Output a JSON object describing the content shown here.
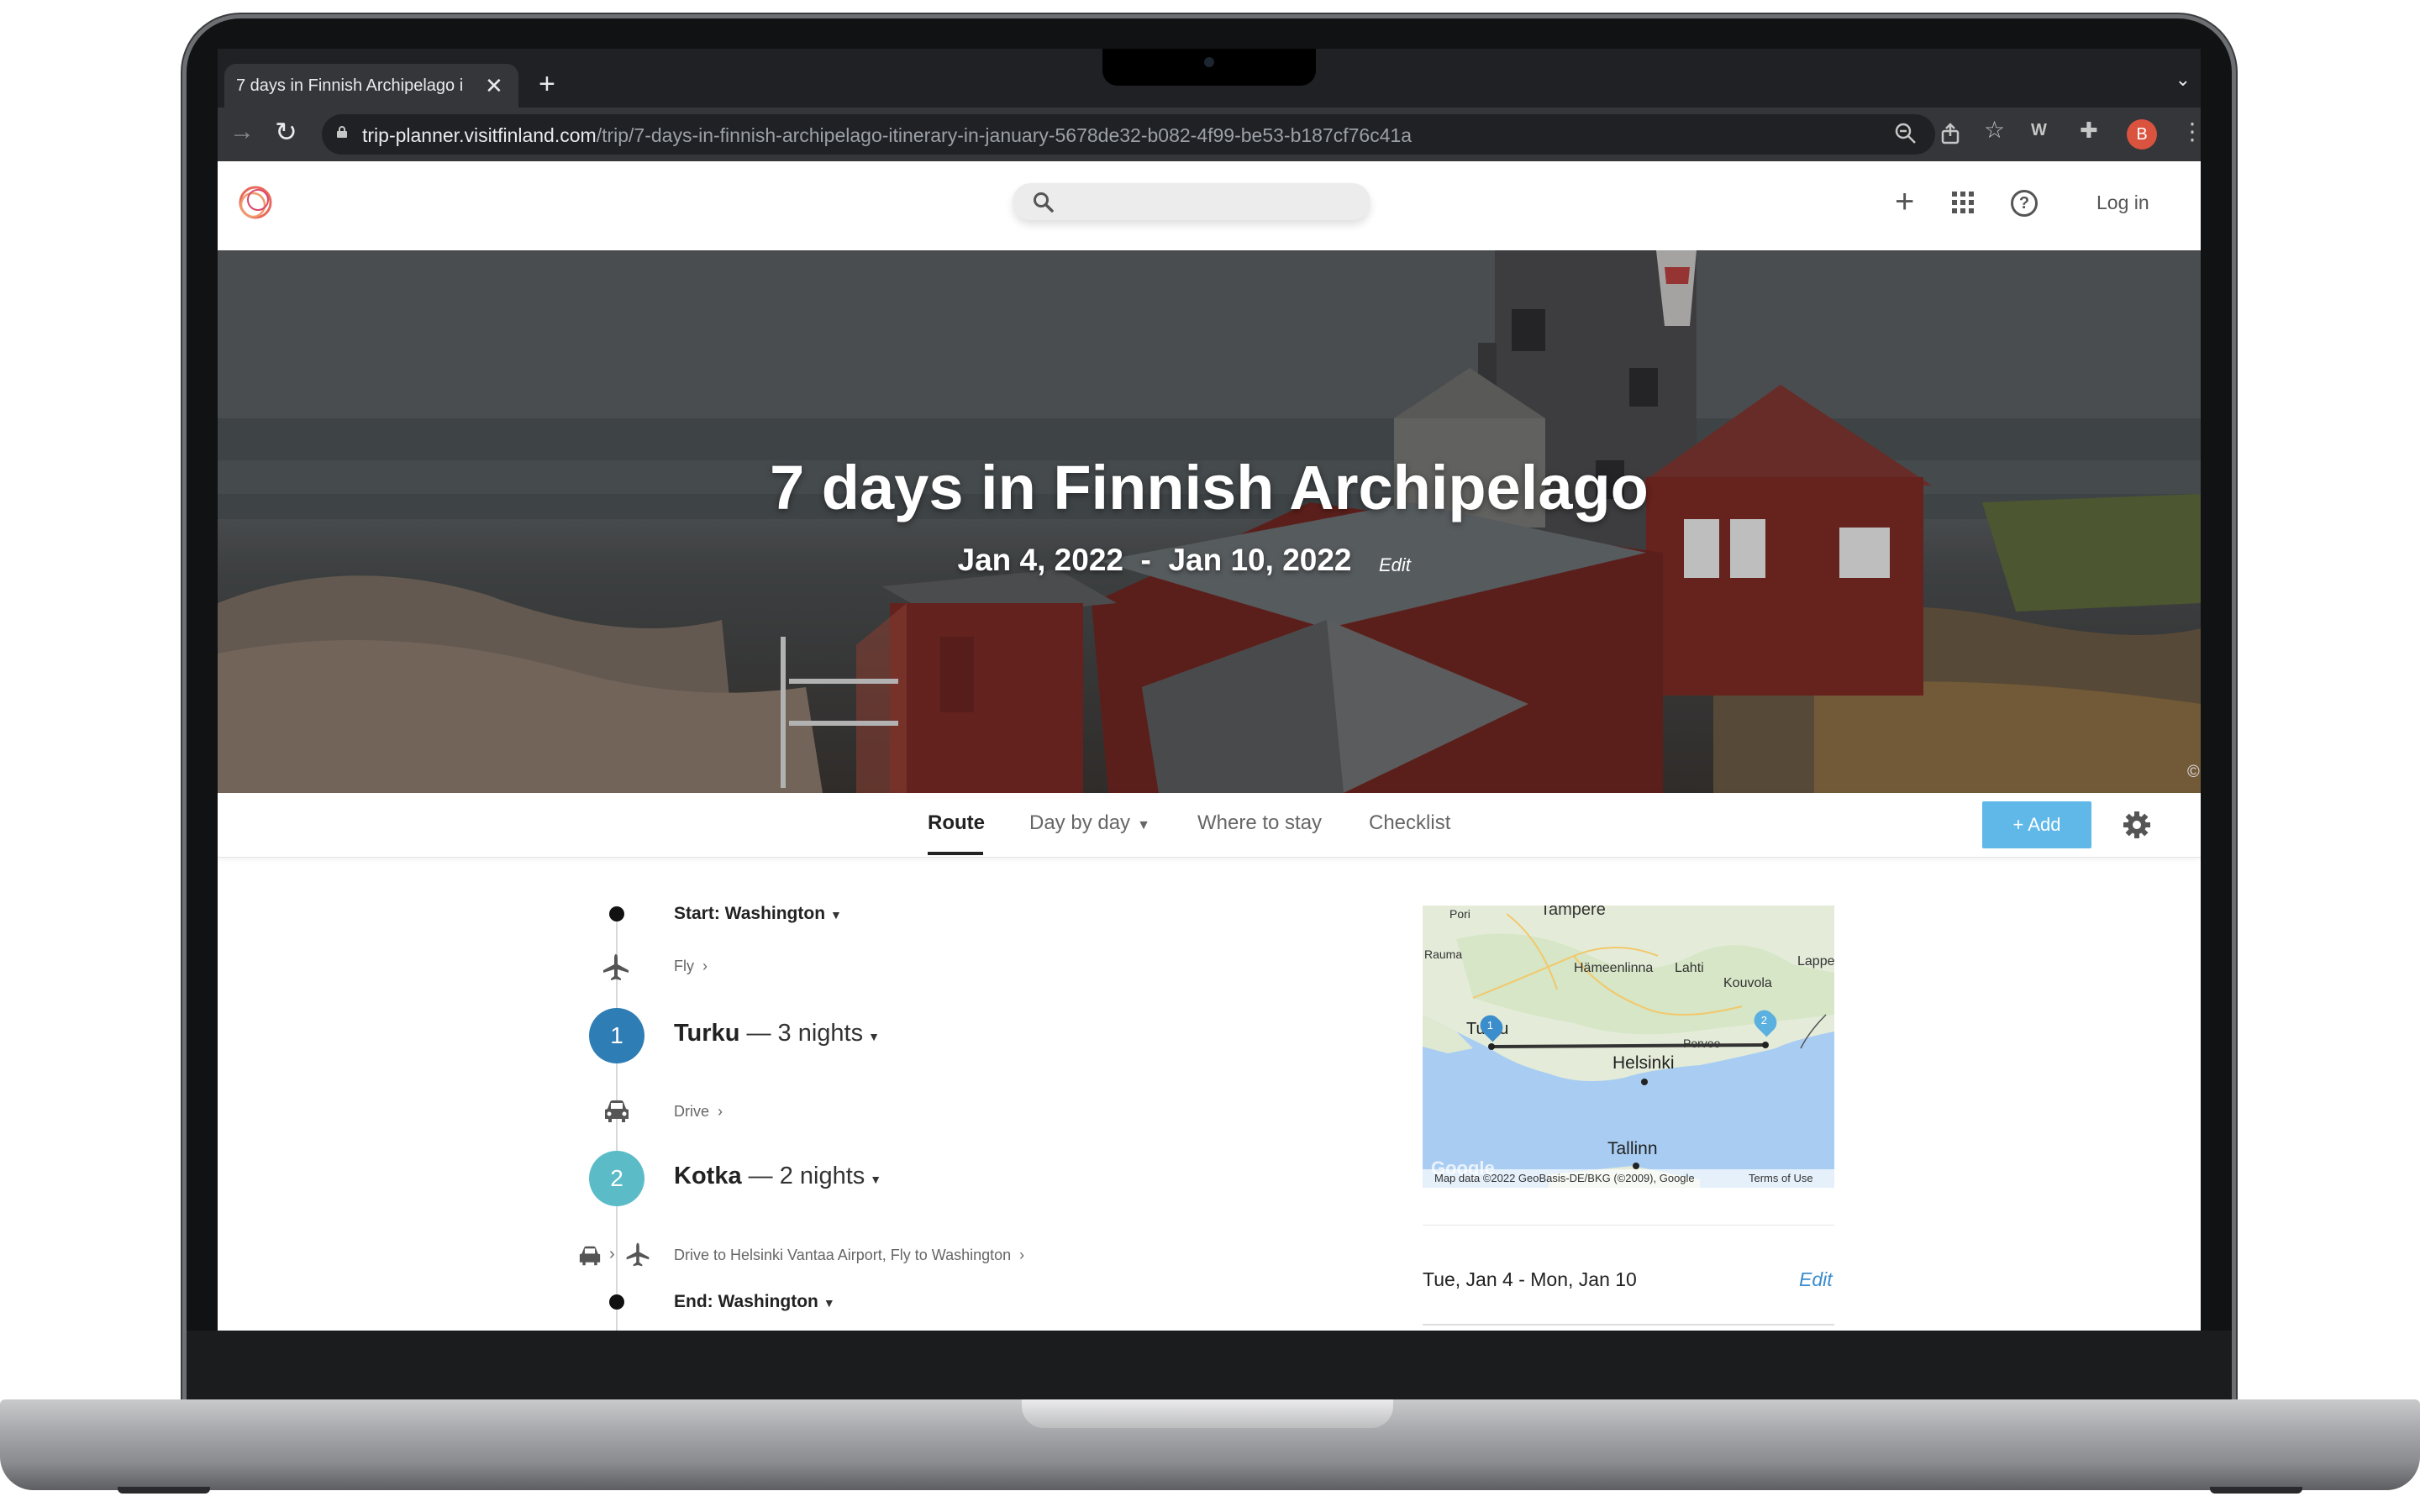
{
  "browser": {
    "tab_title": "7 days in Finnish Archipelago i",
    "tab_close": "✕",
    "new_tab": "+",
    "url_host": "trip-planner.visitfinland.com",
    "url_path": "/trip/7-days-in-finnish-archipelago-itinerary-in-january-5678de32-b082-4f99-be53-b187cf76c41a",
    "profile_initial": "B"
  },
  "header": {
    "search_placeholder": "",
    "login_label": "Log in",
    "plus_label": "+",
    "help_label": "?"
  },
  "hero": {
    "title": "7 days in Finnish Archipelago",
    "date_start": "Jan 4, 2022",
    "date_sep": "-",
    "date_end": "Jan 10, 2022",
    "edit_label": "Edit",
    "copyright": "©"
  },
  "subnav": {
    "tabs": [
      {
        "label": "Route"
      },
      {
        "label": "Day by day"
      },
      {
        "label": "Where to stay"
      },
      {
        "label": "Checklist"
      }
    ],
    "add_label": "+ Add"
  },
  "route": {
    "start_label": "Start: Washington",
    "fly_label": "Fly",
    "stops": [
      {
        "number": "1",
        "city": "Turku",
        "nights": "— 3 nights",
        "color": "#2f7db5"
      },
      {
        "number": "2",
        "city": "Kotka",
        "nights": "— 2 nights",
        "color": "#5bbcc8"
      }
    ],
    "drive_label": "Drive",
    "return_label": "Drive to Helsinki Vantaa Airport, Fly to Washington",
    "end_label": "End: Washington"
  },
  "map": {
    "labels": {
      "pori": "Pori",
      "tampere": "Tampere",
      "rauma": "Rauma",
      "hameenlinna": "Hämeenlinna",
      "lahti": "Lahti",
      "kouvola": "Kouvola",
      "lappe": "Lappe",
      "turku": "Turku",
      "porvoo": "Porvoo",
      "helsinki": "Helsinki",
      "tallinn": "Tallinn",
      "google": "Google"
    },
    "markers": [
      "1",
      "2"
    ],
    "attribution": "Map data ©2022 GeoBasis-DE/BKG (©2009), Google",
    "terms": "Terms of Use",
    "water_color": "#a9cdf2",
    "land_color": "#e8efe0"
  },
  "trip_dates": {
    "label": "Tue, Jan 4 - Mon, Jan 10",
    "edit_label": "Edit"
  }
}
